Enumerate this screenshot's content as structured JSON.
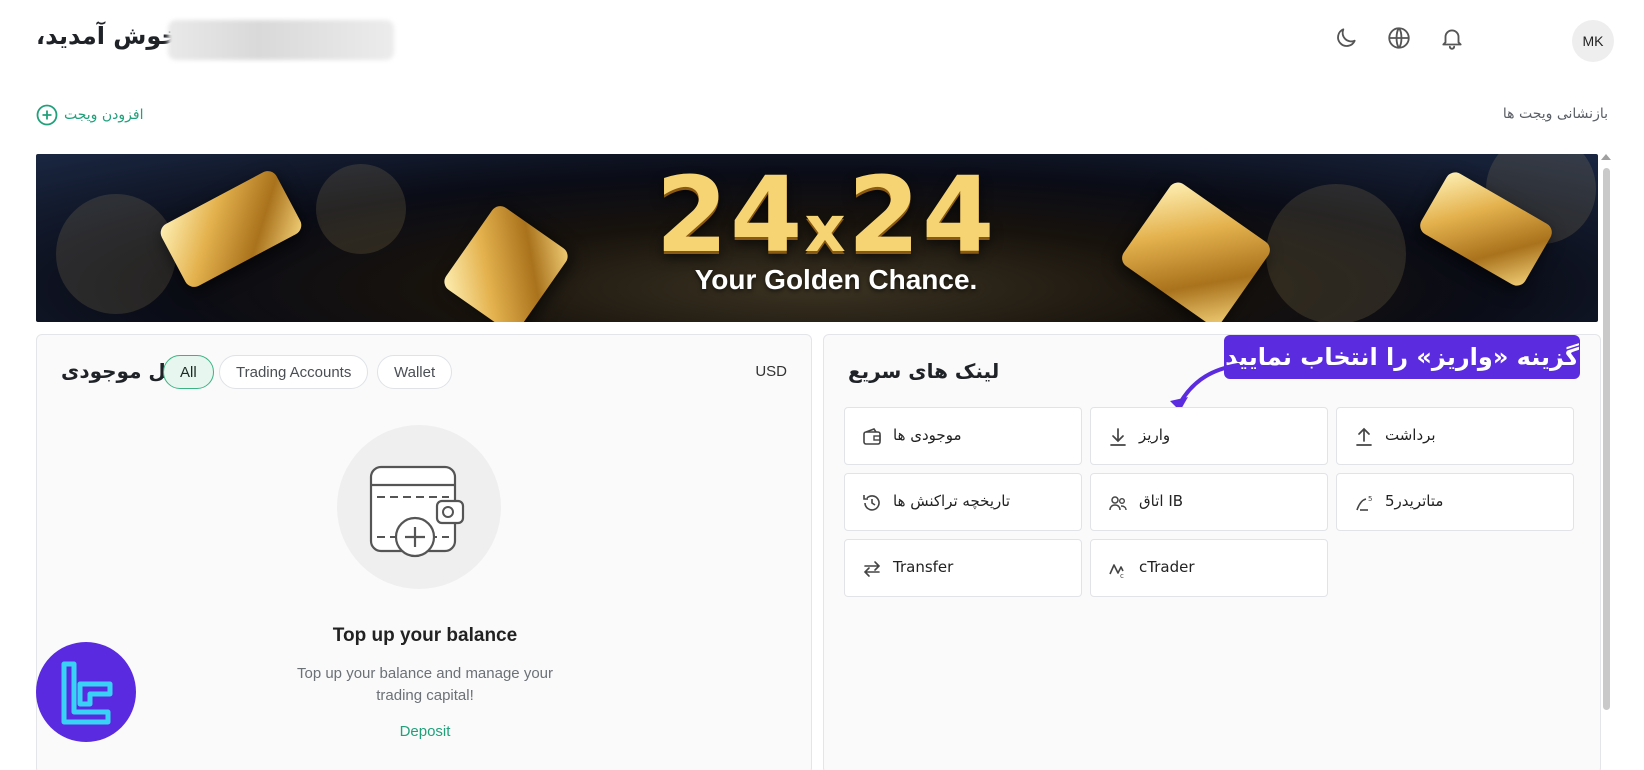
{
  "header": {
    "welcome": "خوش آمدید،",
    "avatar_initials": "MK",
    "icons": [
      "moon-icon",
      "globe-icon",
      "bell-icon"
    ]
  },
  "widgets": {
    "add_label": "افزودن ویجت",
    "reset_label": "بازنشانی ویجت ها"
  },
  "banner": {
    "headline_left": "24",
    "headline_x": "x",
    "headline_right": "24",
    "subline": "Your Golden Chance."
  },
  "balance_card": {
    "title": "کل موجودی",
    "filters": [
      "All",
      "Trading Accounts",
      "Wallet"
    ],
    "active_filter": "All",
    "currency": "USD",
    "empty_title": "Top up your balance",
    "empty_text": "Top up your balance and manage your trading capital!",
    "deposit_label": "Deposit"
  },
  "quick_links": {
    "title": "لینک های سریع",
    "tip": "گزینه «واریز» را انتخاب نمایید",
    "items": [
      {
        "label": "موجودی ها",
        "icon": "wallet-icon"
      },
      {
        "label": "واریز",
        "icon": "download-icon"
      },
      {
        "label": "برداشت",
        "icon": "upload-icon"
      },
      {
        "label": "تاریخچه تراکنش ها",
        "icon": "history-icon"
      },
      {
        "label": "اتاق IB",
        "icon": "users-icon"
      },
      {
        "label": "متاتریدر5",
        "icon": "metatrader-icon"
      },
      {
        "label": "Transfer",
        "icon": "transfer-icon"
      },
      {
        "label": "cTrader",
        "icon": "ctrader-icon"
      }
    ]
  },
  "colors": {
    "accent": "#21a07a",
    "tip_bg": "#5b2be0",
    "logo_bg": "#5a2ae0"
  }
}
